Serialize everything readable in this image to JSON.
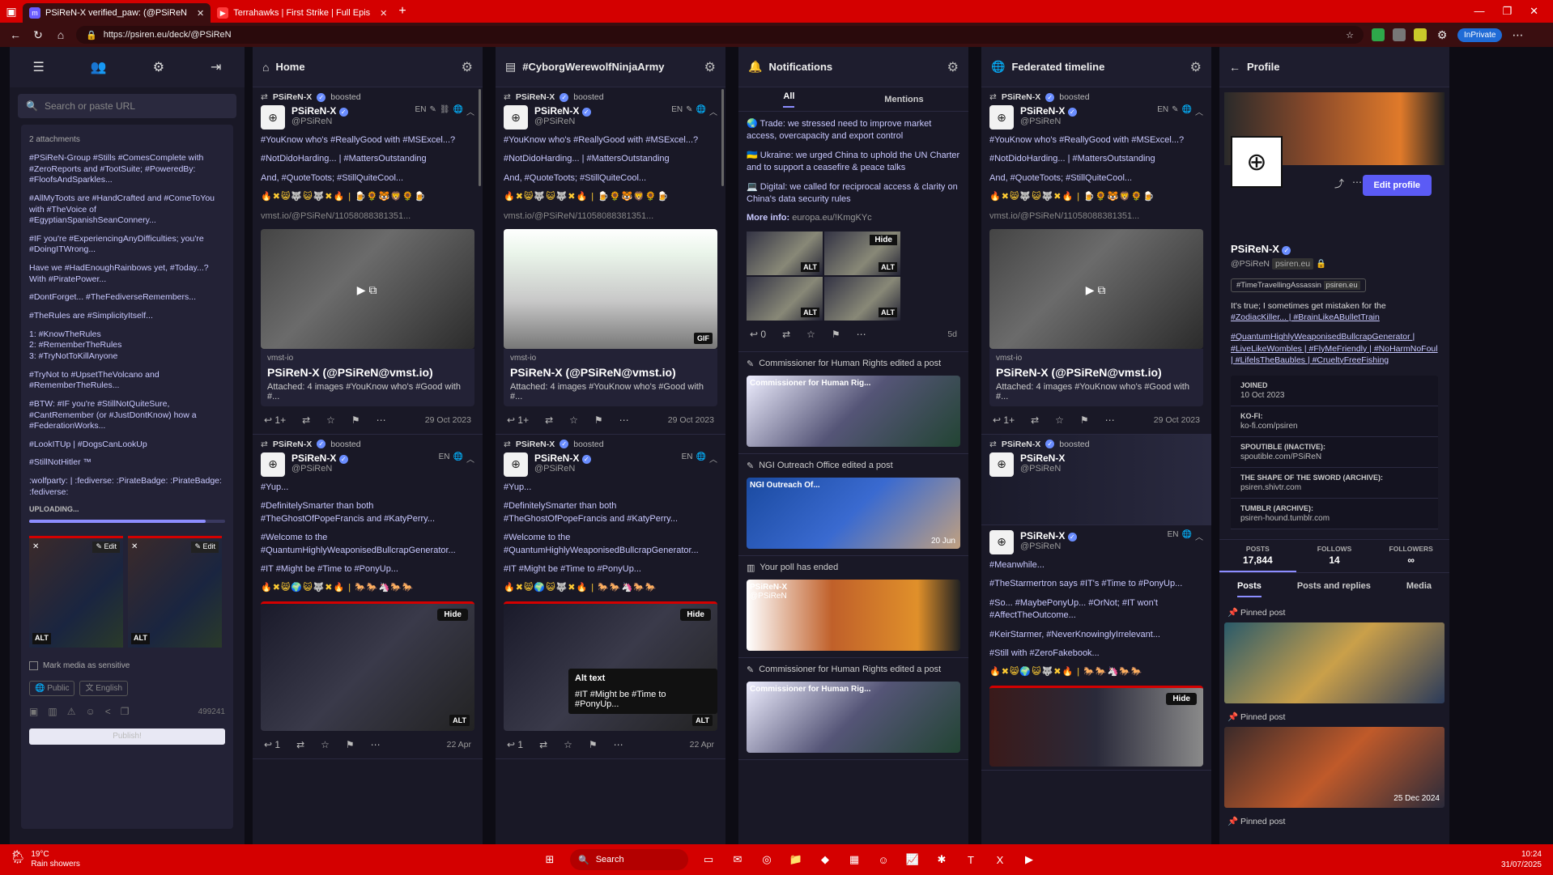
{
  "browser": {
    "tabs": [
      {
        "title": "PSiReN-X verified_paw: (@PSiReN",
        "active": true
      },
      {
        "title": "Terrahawks | First Strike | Full Epis",
        "active": false
      }
    ],
    "url": "https://psiren.eu/deck/@PSiReN",
    "inprivate": "InPrivate"
  },
  "compose": {
    "search_placeholder": "Search or paste URL",
    "attachments": "2 attachments",
    "lines": [
      "#PSiReN-Group #Stills #ComesComplete with #ZeroReports and #TootSuite; #PoweredBy: #FloofsAndSparkles...",
      "#AllMyToots are #HandCrafted and #ComeToYou with #TheVoice of #EgyptianSpanishSeanConnery...",
      "#IF you're #ExperiencingAnyDifficulties; you're #DoingITWrong...",
      "Have we #HadEnoughRainbows yet, #Today...? With #PiratePower...",
      "#DontForget... #TheFediverseRemembers...",
      "#TheRules are #SimplicityItself...",
      "1: #KnowTheRules\n2: #RememberTheRules\n3: #TryNotToKillAnyone",
      "#TryNot to #UpsetTheVolcano and #RememberTheRules...",
      "#BTW: #IF you're #StillNotQuiteSure, #CantRemember (or #JustDontKnow) how a #FederationWorks...",
      "#LookITUp | #DogsCanLookUp",
      "#StillNotHitler ™",
      ":wolfparty: | :fediverse: :PirateBadge: :PirateBadge: :fediverse:"
    ],
    "uploading": "UPLOADING...",
    "upload_progress": 0.9,
    "alt": "ALT",
    "edit": "Edit",
    "sensitive": "Mark media as sensitive",
    "visibility": "Public",
    "language": "English",
    "char_count": "499241",
    "publish": "Publish!"
  },
  "columns": {
    "home": {
      "title": "Home"
    },
    "hashtag": {
      "title": "#CyborgWerewolfNinjaArmy"
    },
    "notifications": {
      "title": "Notifications",
      "tab_all": "All",
      "tab_mentions": "Mentions"
    },
    "federated": {
      "title": "Federated timeline"
    },
    "profile": {
      "title": "Profile"
    }
  },
  "post1": {
    "booster": "PSiReN-X",
    "boosted": "boosted",
    "name": "PSiReN-X",
    "handle": "@PSiReN",
    "lang": "EN",
    "p1": "#YouKnow who's #ReallyGood with #MSExcel...?",
    "p2": "#NotDidoHarding... | #MattersOutstanding",
    "p3": "And, #QuoteToots; #StillQuiteCool...",
    "emojis": "🔥✖😸🐺😺🐺✖🔥 | 🍺🌻🐯🦁🌻🍺",
    "link": "vmst.io/@PSiReN/11058088381351...",
    "card_site": "vmst-io",
    "card_title": "PSiReN-X (@PSiReN@vmst.io)",
    "card_desc": "Attached: 4 images #YouKnow who's #Good with #...",
    "replies": "1+",
    "date": "29 Oct 2023",
    "gif": "GIF"
  },
  "post2": {
    "booster": "PSiReN-X",
    "boosted": "boosted",
    "name": "PSiReN-X",
    "handle": "@PSiReN",
    "lang": "EN",
    "p1": "#Yup...",
    "p2": "#DefinitelySmarter than both #TheGhostOfPopeFrancis and #KatyPerry...",
    "p3": "#Welcome to the #QuantumHighlyWeaponisedBullcrapGenerator...",
    "p4": "#IT #Might be #Time to #PonyUp...",
    "emojis": "🔥✖😸🌍😺🐺✖🔥 | 🐎🐎🦄🐎🐎",
    "hide": "Hide",
    "alt": "ALT",
    "alt_text_title": "Alt text",
    "alt_text": "#IT #Might be #Time to #PonyUp...",
    "replies": "1",
    "date": "22 Apr"
  },
  "notifications": {
    "lines": [
      "🌏 Trade: we stressed need to improve market access, overcapacity and export control",
      "🇺🇦 Ukraine: we urged China to uphold the UN Charter and to support a ceasefire & peace talks",
      "💻 Digital: we called for reciprocal access & clarity on China's data security rules"
    ],
    "more_info_label": "More info:",
    "more_info_link": "europa.eu/!KmgKYc",
    "hide": "Hide",
    "alt": "ALT",
    "replies": "0",
    "age": "5d",
    "n1": "Commissioner for Human Rights edited a post",
    "n1_card": "Commissioner for Human Rig...",
    "n2": "NGI Outreach Office edited a post",
    "n2_card": "NGI Outreach Of...",
    "n2_date": "20 Jun",
    "n3": "Your poll has ended",
    "n3_name": "PSiReN-X",
    "n3_handle": "@PSiReN",
    "n4": "Commissioner for Human Rights edited a post",
    "n4_card": "Commissioner for Human Rig..."
  },
  "federated": {
    "p_more1": "#Meanwhile...",
    "p_more2": "#TheStarmertron says #IT's #Time to #PonyUp...",
    "p_more3": "#So... #MaybePonyUp... #OrNot; #IT won't #AffectTheOutcome...",
    "p_more4": "#KeirStarmer, #NeverKnowinglyIrrelevant...",
    "p_more5": "#Still with #ZeroFakebook..."
  },
  "profile": {
    "name": "PSiReN-X",
    "handle": "@PSiReN",
    "domain": "psiren.eu",
    "edit": "Edit profile",
    "tag": "#TimeTravellingAssassin",
    "tag_domain": "psiren.eu",
    "bio_plain": "It's true; I sometimes get mistaken for the",
    "bio_tags1": "#ZodiacKiller... | #BrainLikeABulletTrain",
    "bio_tags2": "#QuantumHighlyWeaponisedBullcrapGenerator | #LiveLikeWombles | #FlyMeFriendly | #NoHarmNoFoul | #LifelsTheBaubles | #CrueltyFreeFishing",
    "fields": [
      {
        "k": "JOINED",
        "v": "10 Oct 2023"
      },
      {
        "k": "KO-FI:",
        "v": "ko-fi.com/psiren"
      },
      {
        "k": "SPOUTIBLE (INACTIVE):",
        "v": "spoutible.com/PSiReN"
      },
      {
        "k": "THE SHAPE OF THE SWORD (ARCHIVE):",
        "v": "psiren.shivtr.com"
      },
      {
        "k": "TUMBLR (ARCHIVE):",
        "v": "psiren-hound.tumblr.com"
      }
    ],
    "posts_label": "POSTS",
    "posts": "17,844",
    "follows_label": "FOLLOWS",
    "follows": "14",
    "followers_label": "FOLLOWERS",
    "followers": "∞",
    "tab_posts": "Posts",
    "tab_replies": "Posts and replies",
    "tab_media": "Media",
    "pinned": "Pinned post",
    "pin_date": "25 Dec 2024"
  },
  "taskbar": {
    "temp": "19°C",
    "weather": "Rain showers",
    "search": "Search",
    "time": "10:24",
    "date": "31/07/2025"
  }
}
